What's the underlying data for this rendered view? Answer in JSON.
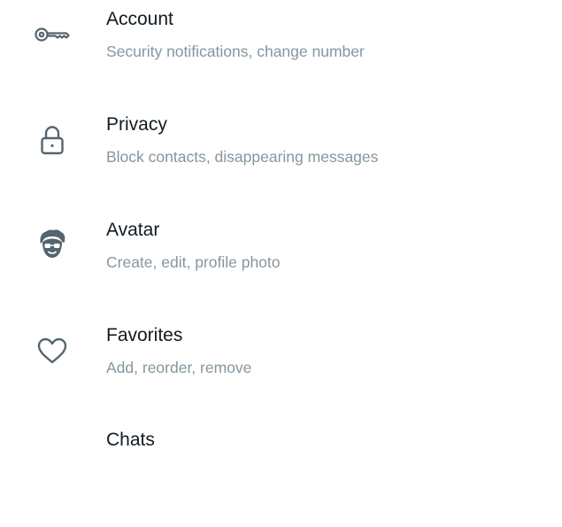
{
  "settings": {
    "items": [
      {
        "id": "account",
        "title": "Account",
        "subtitle": "Security notifications, change number",
        "icon": "key-icon"
      },
      {
        "id": "privacy",
        "title": "Privacy",
        "subtitle": "Block contacts, disappearing messages",
        "icon": "lock-icon"
      },
      {
        "id": "avatar",
        "title": "Avatar",
        "subtitle": "Create, edit, profile photo",
        "icon": "avatar-icon"
      },
      {
        "id": "favorites",
        "title": "Favorites",
        "subtitle": "Add, reorder, remove",
        "icon": "heart-icon"
      },
      {
        "id": "chats",
        "title": "Chats",
        "subtitle": "",
        "icon": ""
      }
    ]
  },
  "colors": {
    "title": "#111b21",
    "subtitle": "#8696a0",
    "icon": "#54656f",
    "background": "#ffffff"
  }
}
